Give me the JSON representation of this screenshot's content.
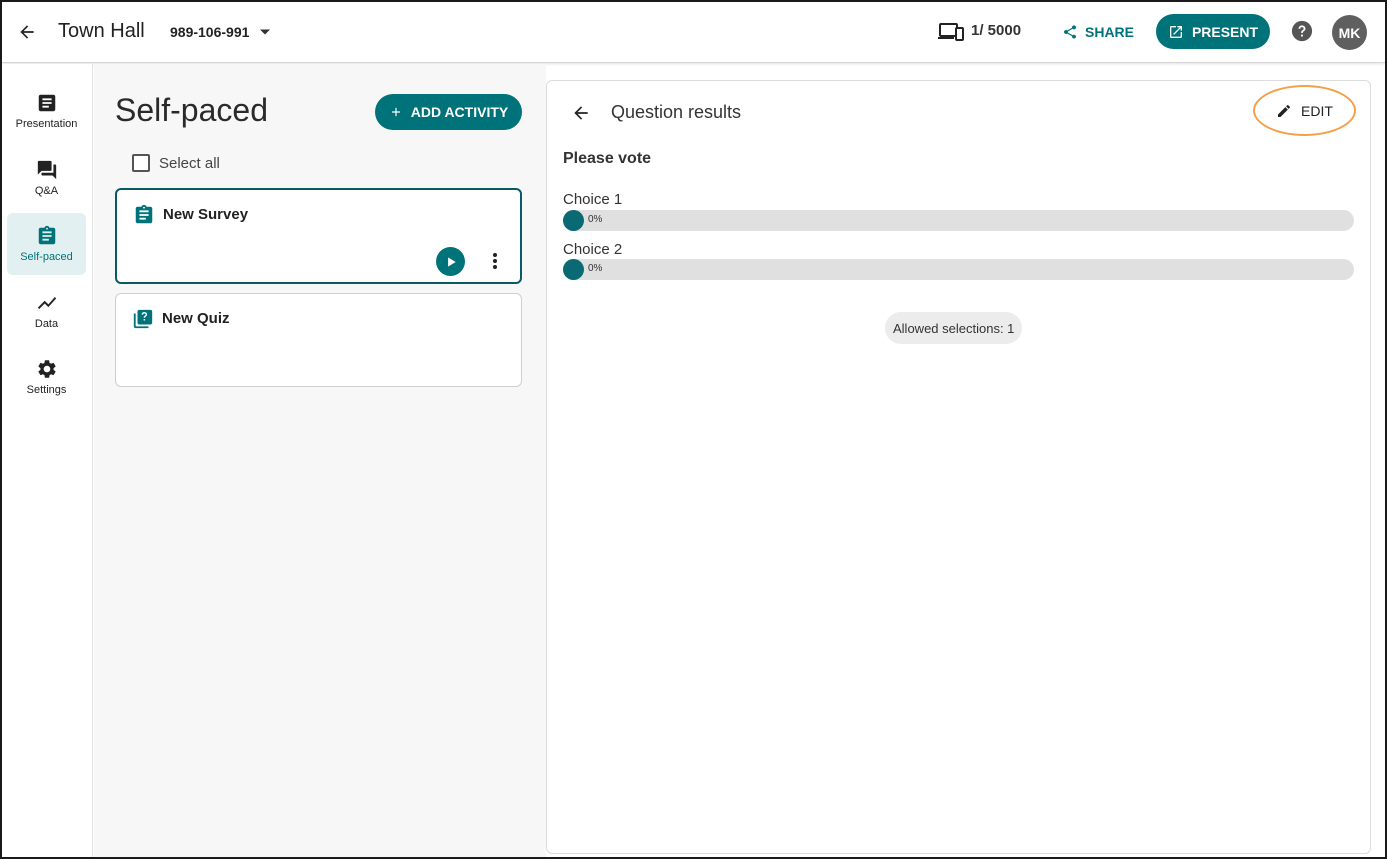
{
  "header": {
    "title": "Town Hall",
    "event_code": "989-106-991",
    "attendees": "1/ 5000",
    "share_label": "SHARE",
    "present_label": "PRESENT",
    "avatar_initials": "MK"
  },
  "sidebar": {
    "items": [
      {
        "label": "Presentation",
        "icon": "presentation-icon"
      },
      {
        "label": "Q&A",
        "icon": "qa-icon"
      },
      {
        "label": "Self-paced",
        "icon": "clipboard-icon",
        "active": true
      },
      {
        "label": "Data",
        "icon": "chart-line-icon"
      },
      {
        "label": "Settings",
        "icon": "gear-icon"
      }
    ]
  },
  "activities": {
    "title": "Self-paced",
    "add_label": "ADD ACTIVITY",
    "select_all_label": "Select all",
    "cards": [
      {
        "title": "New Survey",
        "icon": "survey-icon",
        "selected": true
      },
      {
        "title": "New Quiz",
        "icon": "quiz-icon",
        "selected": false
      }
    ]
  },
  "results": {
    "title": "Question results",
    "edit_label": "EDIT",
    "question": "Please vote",
    "choices": [
      {
        "label": "Choice 1",
        "percent": 0,
        "percent_label": "0%"
      },
      {
        "label": "Choice 2",
        "percent": 0,
        "percent_label": "0%"
      }
    ],
    "allowed_selections": "Allowed selections: 1"
  },
  "colors": {
    "accent": "#00737a",
    "highlight_ring": "#f4a04a"
  }
}
